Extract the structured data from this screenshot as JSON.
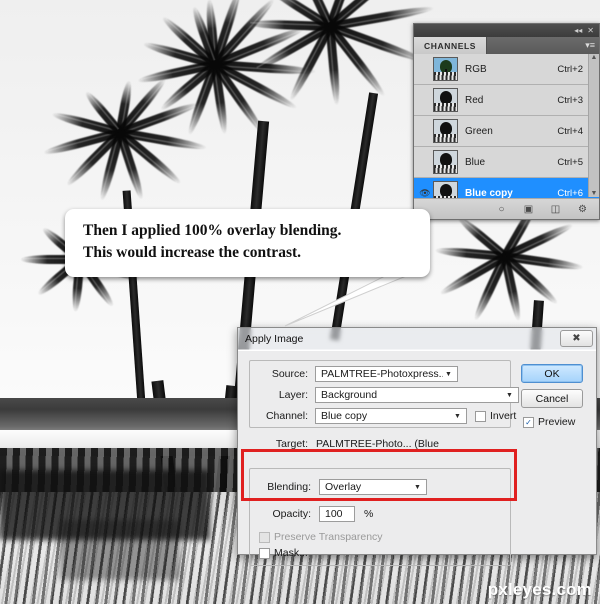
{
  "annotation": {
    "lines": [
      "Then I applied 100% overlay blending.",
      "This would increase the contrast."
    ]
  },
  "watermark": "pxleyes.com",
  "channels_panel": {
    "tab_label": "CHANNELS",
    "collapse_icon": "◂◂",
    "close_icon": "✕",
    "menu_icon": "▾≡",
    "scroll_up_icon": "▲",
    "scroll_down_icon": "▼",
    "rows": [
      {
        "name": "RGB",
        "shortcut": "Ctrl+2",
        "visible": false,
        "selected": false,
        "thumb": "color"
      },
      {
        "name": "Red",
        "shortcut": "Ctrl+3",
        "visible": false,
        "selected": false,
        "thumb": "gray"
      },
      {
        "name": "Green",
        "shortcut": "Ctrl+4",
        "visible": false,
        "selected": false,
        "thumb": "gray"
      },
      {
        "name": "Blue",
        "shortcut": "Ctrl+5",
        "visible": false,
        "selected": false,
        "thumb": "gray"
      },
      {
        "name": "Blue copy",
        "shortcut": "Ctrl+6",
        "visible": true,
        "selected": true,
        "thumb": "gray"
      }
    ],
    "footer_icons": [
      {
        "name": "load-channel-as-selection-icon",
        "glyph": "○"
      },
      {
        "name": "save-selection-as-channel-icon",
        "glyph": "▣"
      },
      {
        "name": "new-channel-icon",
        "glyph": "⧉"
      },
      {
        "name": "delete-channel-icon",
        "glyph": "Ὕ1"
      }
    ]
  },
  "dialog": {
    "title": "Apply Image",
    "close_glyph": "✖",
    "source_label": "Source:",
    "source_value": "PALMTREE-Photoxpress...",
    "layer_label": "Layer:",
    "layer_value": "Background",
    "channel_label": "Channel:",
    "channel_value": "Blue copy",
    "invert_label": "Invert",
    "invert_checked": false,
    "target_label": "Target:",
    "target_value": "PALMTREE-Photo... (Blue",
    "blending_label": "Blending:",
    "blending_value": "Overlay",
    "opacity_label": "Opacity:",
    "opacity_value": "100",
    "opacity_unit": "%",
    "preserve_transparency_label": "Preserve Transparency",
    "preserve_transparency_enabled": false,
    "mask_label": "Mask...",
    "ok_label": "OK",
    "cancel_label": "Cancel",
    "preview_label": "Preview",
    "preview_checked": true,
    "check_glyph": "✓",
    "dropdown_glyph": "▼"
  },
  "colors": {
    "selection_blue": "#1f8fff",
    "highlight_red": "#e02020",
    "dialog_face": "#ececed",
    "panel_face": "#d7d7d7"
  }
}
